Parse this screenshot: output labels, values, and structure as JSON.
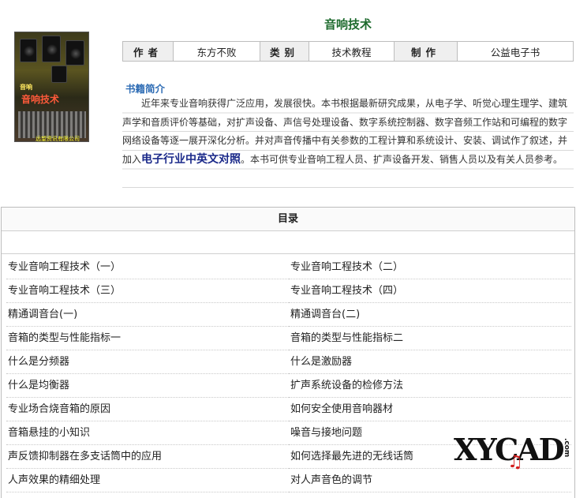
{
  "book": {
    "title": "音响技术",
    "cover": {
      "top_text": "音响",
      "title_text": "音响技术",
      "publisher": "远望资讯有限公司"
    },
    "meta": {
      "author_label": "作者",
      "author": "东方不败",
      "category_label": "类别",
      "category": "技术教程",
      "maker_label": "制作",
      "maker": "公益电子书"
    },
    "intro": {
      "heading": "书籍简介",
      "text_before": "近年来专业音响获得广泛应用，发展很快。本书根据最新研究成果，从电子学、听觉心理生理学、建筑声学和音质评价等基础，对扩声设备、声信号处理设备、数字系统控制器、数字音频工作站和可编程的数字网络设备等逐一展开深化分析。并对声音传播中有关参数的工程计算和系统设计、安装、调试作了叙述，并加入",
      "emphasis": "电子行业中英文对照",
      "text_after": "。本书可供专业音响工程人员、扩声设备开发、销售人员以及有关人员参考。"
    }
  },
  "toc": {
    "heading": "目录",
    "rows": [
      [
        "专业音响工程技术（一）",
        "专业音响工程技术（二）"
      ],
      [
        "专业音响工程技术（三）",
        "专业音响工程技术（四）"
      ],
      [
        "精通调音台(一)",
        "精通调音台(二)"
      ],
      [
        "音箱的类型与性能指标一",
        "音箱的类型与性能指标二"
      ],
      [
        "什么是分频器",
        "什么是激励器"
      ],
      [
        "什么是均衡器",
        "扩声系统设备的检修方法"
      ],
      [
        "专业场合烧音箱的原因",
        "如何安全使用音响器材"
      ],
      [
        "音箱悬挂的小知识",
        "噪音与接地问题"
      ],
      [
        "声反馈抑制器在多支话筒中的应用",
        "如何选择最先进的无线话筒"
      ],
      [
        "人声效果的精细处理",
        "对人声音色的调节"
      ]
    ]
  },
  "watermark": {
    "text": "XYCAD",
    "suffix": ".com"
  },
  "colors": {
    "title": "#1e6b2e",
    "intro_heading": "#2f6db5",
    "emphasis": "#1b2a8a"
  }
}
